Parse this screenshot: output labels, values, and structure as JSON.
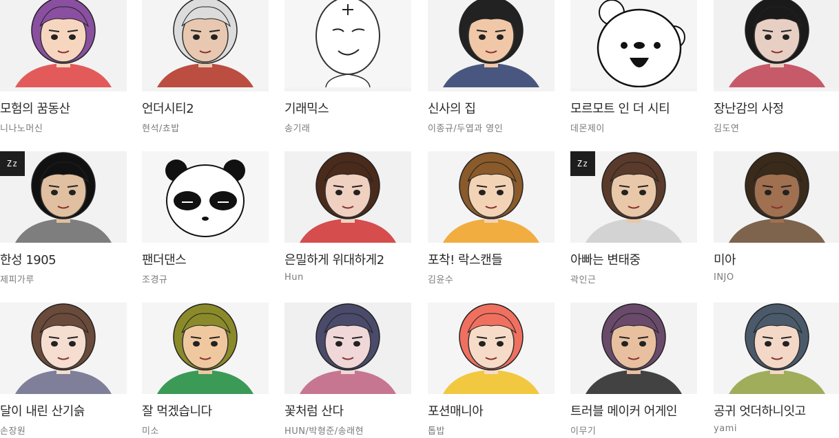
{
  "badge_text": "Zz",
  "comics": [
    {
      "title": "모험의 꿈동산",
      "author": "니나노머신",
      "sleep_badge": false,
      "icon": "girl-purple-hair-icon",
      "colors": {
        "bg": "#f2f2f2",
        "hair": "#8a4fa0",
        "skin": "#f7d6c0",
        "accent": "#e04040"
      }
    },
    {
      "title": "언더시티2",
      "author": "현석/쵸밥",
      "sleep_badge": false,
      "icon": "white-hair-man-icon",
      "colors": {
        "bg": "#f4f4f4",
        "hair": "#dcdcdc",
        "skin": "#e8c8b0",
        "accent": "#b03020"
      }
    },
    {
      "title": "기래믹스",
      "author": "송기래",
      "sleep_badge": false,
      "icon": "sketch-face-icon",
      "colors": {
        "bg": "#f6f6f6",
        "hair": "#333333",
        "skin": "#ffffff",
        "accent": "#222222"
      }
    },
    {
      "title": "신사의 집",
      "author": "이종규/두엽과 영인",
      "sleep_badge": false,
      "icon": "boy-necktie-icon",
      "colors": {
        "bg": "#f3f3f3",
        "hair": "#222222",
        "skin": "#f0c8a8",
        "accent": "#2a3a6a"
      }
    },
    {
      "title": "모르모트 인 더 시티",
      "author": "데몬제이",
      "sleep_badge": false,
      "icon": "white-bear-icon",
      "colors": {
        "bg": "#f5f5f5",
        "hair": "#ffffff",
        "skin": "#ffffff",
        "accent": "#111111"
      }
    },
    {
      "title": "장난감의 사정",
      "author": "김도연",
      "sleep_badge": false,
      "icon": "dark-hair-girl-icon",
      "colors": {
        "bg": "#f1f1f1",
        "hair": "#1a1a1a",
        "skin": "#e8cfc4",
        "accent": "#c04050"
      }
    },
    {
      "title": "한성 1905",
      "author": "제피가루",
      "sleep_badge": true,
      "icon": "top-hat-gunman-icon",
      "colors": {
        "bg": "#f2f2f2",
        "hair": "#111111",
        "skin": "#e0c0a0",
        "accent": "#6a6a6a"
      }
    },
    {
      "title": "팬더댄스",
      "author": "조경규",
      "sleep_badge": false,
      "icon": "panda-icon",
      "colors": {
        "bg": "#f6f6f6",
        "hair": "#111111",
        "skin": "#ffffff",
        "accent": "#111111"
      }
    },
    {
      "title": "은밀하게 위대하게2",
      "author": "Hun",
      "sleep_badge": false,
      "icon": "clown-makeup-man-icon",
      "colors": {
        "bg": "#f1f1f1",
        "hair": "#4a2a1a",
        "skin": "#f0d0c0",
        "accent": "#d03030"
      }
    },
    {
      "title": "포착! 락스캔들",
      "author": "김윤수",
      "sleep_badge": false,
      "icon": "thinking-boy-icon",
      "colors": {
        "bg": "#f4f4f4",
        "hair": "#8a5a2a",
        "skin": "#f3d3b5",
        "accent": "#f0a020"
      }
    },
    {
      "title": "아빠는 변태중",
      "author": "곽인근",
      "sleep_badge": true,
      "icon": "newspaper-dad-icon",
      "colors": {
        "bg": "#f3f3f3",
        "hair": "#5a3a2a",
        "skin": "#e8c8a8",
        "accent": "#cccccc"
      }
    },
    {
      "title": "미아",
      "author": "INJO",
      "sleep_badge": false,
      "icon": "dark-skin-girl-icon",
      "colors": {
        "bg": "#f2f2f2",
        "hair": "#3a2a1a",
        "skin": "#a07050",
        "accent": "#6a4a30"
      }
    },
    {
      "title": "달이 내린 산기슭",
      "author": "손장원",
      "sleep_badge": false,
      "icon": "hat-girl-icon",
      "colors": {
        "bg": "#f4f4f4",
        "hair": "#6a4a3a",
        "skin": "#f5ddd0",
        "accent": "#6a6a8a"
      }
    },
    {
      "title": "잘 먹겠습니다",
      "author": "미소",
      "sleep_badge": false,
      "icon": "burger-boy-icon",
      "colors": {
        "bg": "#f5f5f5",
        "hair": "#8a8a2a",
        "skin": "#f0c8a0",
        "accent": "#1a8a3a"
      }
    },
    {
      "title": "꽃처럼 산다",
      "author": "HUN/박형준/송래현",
      "sleep_badge": false,
      "icon": "profile-girl-icon",
      "colors": {
        "bg": "#f0f0f0",
        "hair": "#4a4a6a",
        "skin": "#f0d8d8",
        "accent": "#c06080"
      }
    },
    {
      "title": "포션매니아",
      "author": "톱밥",
      "sleep_badge": false,
      "icon": "pink-hair-girl-icon",
      "colors": {
        "bg": "#f5f5f5",
        "hair": "#f07060",
        "skin": "#f6dcc8",
        "accent": "#f0c020"
      }
    },
    {
      "title": "트러블 메이커 어게인",
      "author": "이무기",
      "sleep_badge": false,
      "icon": "hooded-woman-icon",
      "colors": {
        "bg": "#f3f3f3",
        "hair": "#6a4a6a",
        "skin": "#e8c0a0",
        "accent": "#222222"
      }
    },
    {
      "title": "공귀 엇더하니잇고",
      "author": "yami",
      "sleep_badge": false,
      "icon": "two-characters-icon",
      "colors": {
        "bg": "#f4f4f4",
        "hair": "#4a5a6a",
        "skin": "#f3d8c8",
        "accent": "#90a040"
      }
    }
  ]
}
